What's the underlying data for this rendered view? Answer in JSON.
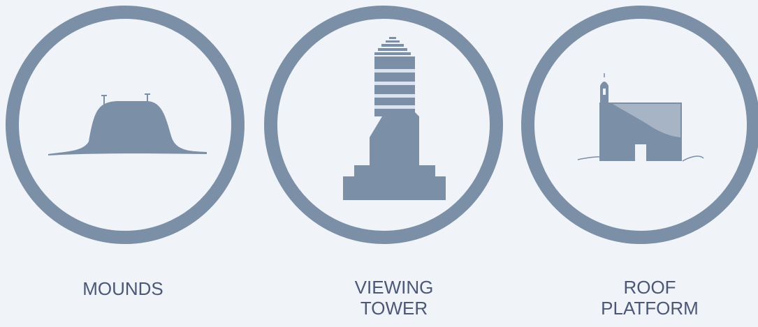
{
  "colors": {
    "background": "#f0f3f8",
    "icon": "#7b8fa6",
    "icon_light": "#a7b4c5",
    "label": "#4b5876"
  },
  "items": [
    {
      "icon": "mound-icon",
      "label_lines": [
        "MOUNDS"
      ]
    },
    {
      "icon": "tower-icon",
      "label_lines": [
        "VIEWING",
        "TOWER"
      ]
    },
    {
      "icon": "building-icon",
      "label_lines": [
        "ROOF",
        "PLATFORM"
      ]
    }
  ]
}
